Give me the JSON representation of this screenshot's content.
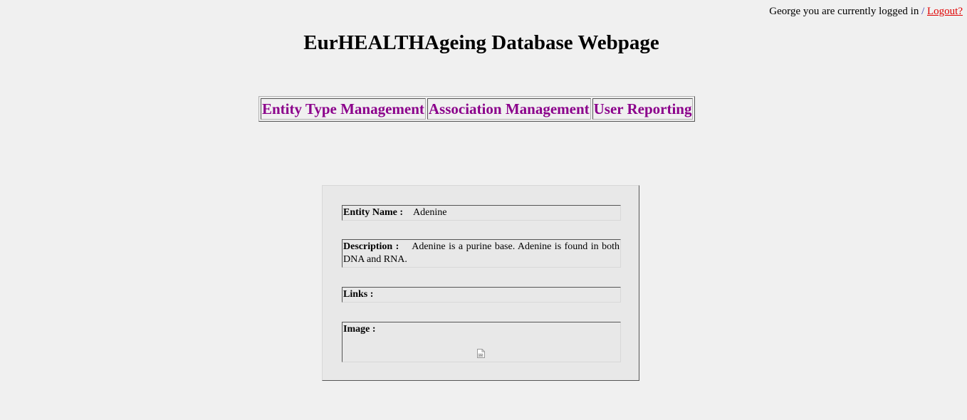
{
  "header": {
    "login_text": "George you are currently logged in",
    "separator": "/",
    "logout_label": "Logout?"
  },
  "page": {
    "title": "EurHEALTHAgeing Database Webpage"
  },
  "nav": {
    "items": [
      {
        "label": "Entity Type Management"
      },
      {
        "label": "Association Management"
      },
      {
        "label": "User Reporting"
      }
    ]
  },
  "entity": {
    "name_label": "Entity Name :",
    "name_value": "Adenine",
    "description_label": "Description :",
    "description_value": "Adenine is a purine base. Adenine is found in both DNA and RNA.",
    "links_label": "Links :",
    "links_value": "",
    "image_label": "Image :",
    "image_icon": "broken-image-icon"
  },
  "colors": {
    "background": "#f0f0f0",
    "panel": "#e8e8e8",
    "nav_link": "#8b008b",
    "logout_link": "#e00000"
  }
}
